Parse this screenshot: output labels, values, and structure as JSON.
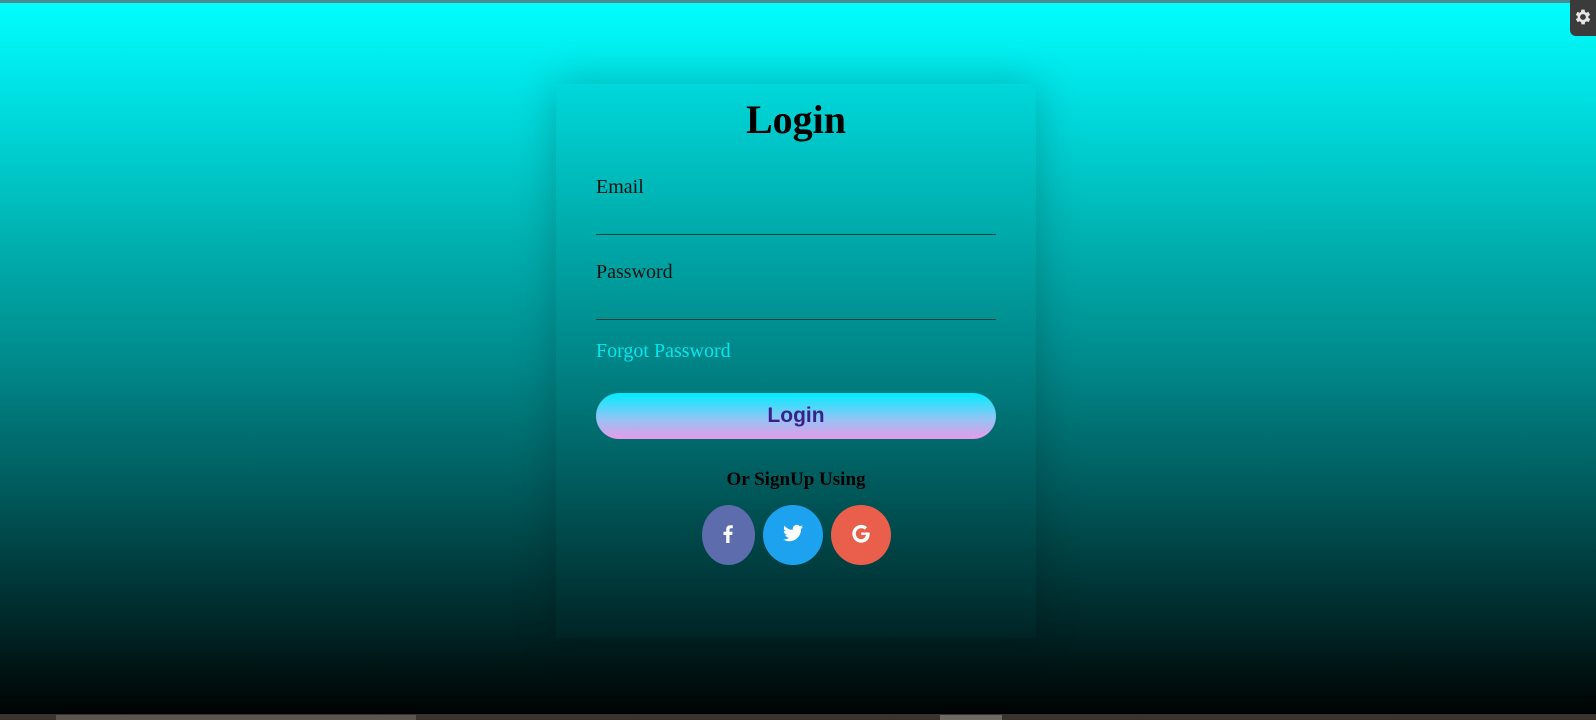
{
  "login_card": {
    "title": "Login",
    "email": {
      "label": "Email",
      "value": "",
      "placeholder": ""
    },
    "password": {
      "label": "Password",
      "value": "",
      "placeholder": ""
    },
    "forgot_password_label": "Forgot Password",
    "login_button_label": "Login",
    "signup_text": "Or SignUp Using",
    "social_buttons": [
      {
        "icon": "facebook-icon",
        "color": "#5c6cad"
      },
      {
        "icon": "twitter-icon",
        "color": "#1da2ef"
      },
      {
        "icon": "google-icon",
        "color": "#e95f4c"
      }
    ]
  },
  "colors": {
    "background_top": "#00ffff",
    "background_bottom": "#000000",
    "forgot_link": "#00e8f0",
    "login_button_text": "#3b1f8a"
  },
  "settings_tab": {
    "icon": "gear-icon"
  }
}
